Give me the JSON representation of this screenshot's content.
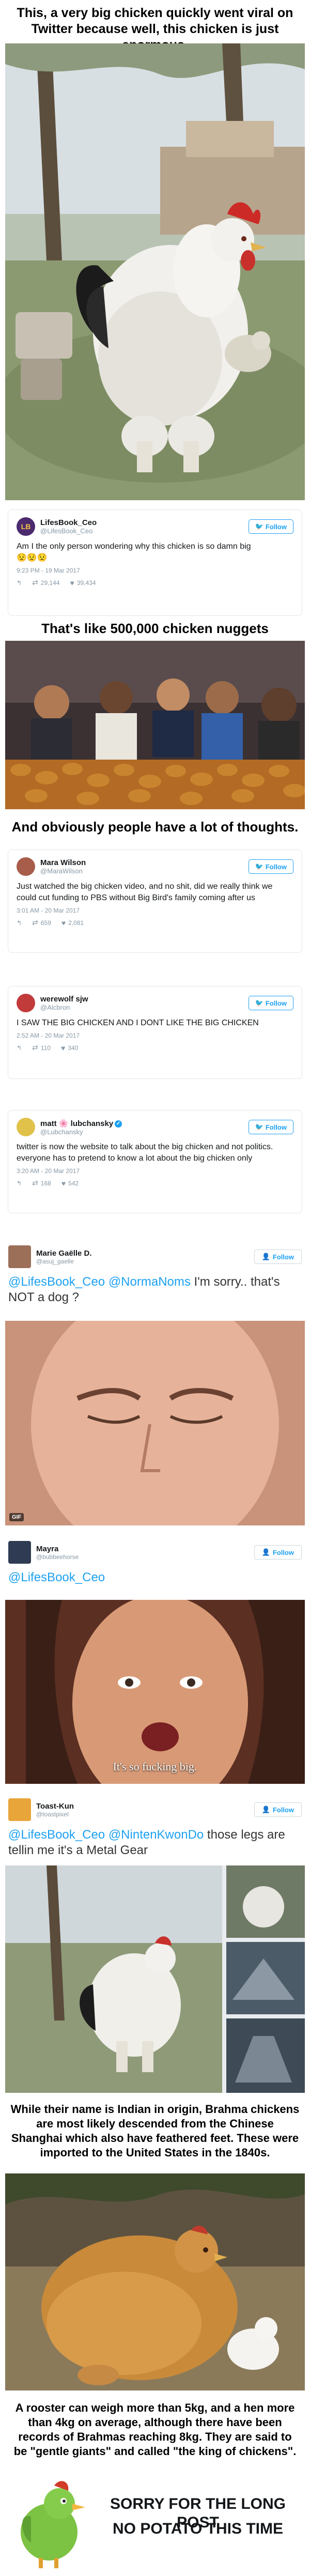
{
  "intro_caption": "This, a very big chicken quickly went viral on Twitter because well, this chicken is just enormous.",
  "tweet1": {
    "name": "LifesBook_Ceo",
    "handle": "@LifesBook_Ceo",
    "follow": "Follow",
    "text": "Am I the only person wondering why this chicken is so damn big",
    "emoji": "😟😟😟",
    "time": "9:23 PM - 19 Mar 2017",
    "retweets": "29,144",
    "likes": "39,434"
  },
  "nuggets_caption": "That's like 500,000 chicken nuggets",
  "thoughts_caption": "And obviously people have a lot of thoughts.",
  "tweet2": {
    "name": "Mara Wilson",
    "handle": "@MaraWilson",
    "follow": "Follow",
    "text": "Just watched the big chicken video, and no shit, did we really think we could cut funding to PBS without Big Bird's family coming after us",
    "time": "3:01 AM - 20 Mar 2017",
    "retweets": "659",
    "likes": "2,081"
  },
  "tweet3": {
    "name": "werewolf sjw",
    "handle": "@Alcbron",
    "follow": "Follow",
    "text": "I SAW THE BIG CHICKEN AND I DONT LIKE THE BIG CHICKEN",
    "time": "2:52 AM - 20 Mar 2017",
    "retweets": "110",
    "likes": "340"
  },
  "tweet4": {
    "name": "matt 🌸 lubchansky",
    "handle": "@Lubchansky",
    "follow": "Follow",
    "text": "twitter is now the website to talk about the big chicken and not politics. everyone has to pretend to know a lot about the big chicken only",
    "time": "3:20 AM - 20 Mar 2017",
    "retweets": "168",
    "likes": "542"
  },
  "reply1": {
    "name": "Marie Gaëlle D.",
    "handle": "@asuj_gaelle",
    "follow": "Follow",
    "mention1": "@LifesBook_Ceo",
    "mention2": "@NormaNoms",
    "text": " I'm sorry.. that's NOT a dog ?",
    "gif": "GIF"
  },
  "reply2": {
    "name": "Mayra",
    "handle": "@bubbeehorse",
    "follow": "Follow",
    "mention1": "@LifesBook_Ceo",
    "overlay": "It's so fucking big."
  },
  "reply3": {
    "name": "Toast-Kun",
    "handle": "@toastpixel",
    "follow": "Follow",
    "mention1": "@LifesBook_Ceo",
    "mention2": "@NintenKwonDo",
    "text": " those legs are tellin me it's a Metal Gear"
  },
  "brahma_caption": "While their name is Indian in origin, Brahma chickens are most likely descended from the Chinese Shanghai which also have feathered feet. These were imported to the United States in the 1840s.",
  "weight_caption": "A rooster can weigh more than 5kg, and a hen more than 4kg on average, although there have been records of Brahmas reaching 8kg. They are said to be \"gentle giants\" and called \"the king of chickens\".",
  "footer": {
    "line1": "SORRY FOR THE LONG POST",
    "line2": "NO POTATO THIS TIME"
  },
  "colors": {
    "twitter_blue": "#1da1f2",
    "muted_gray": "#8899a6"
  }
}
